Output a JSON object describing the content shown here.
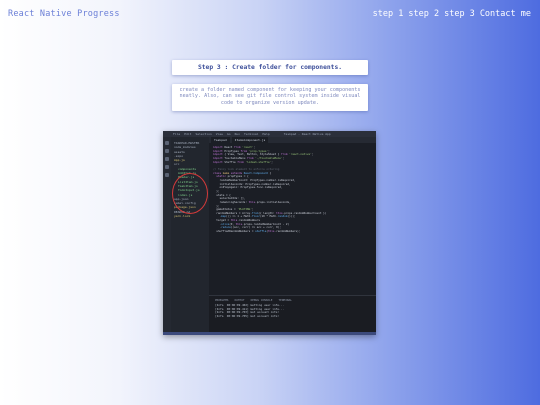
{
  "header": {
    "brand": "React Native Progress",
    "nav": [
      "step 1",
      "step 2",
      "step 3",
      "Contact me"
    ]
  },
  "step": {
    "title": "Step 3 : Create folder for components.",
    "description": "create a folder named component for keeping your components neatly. Also, can see git file control system inside visual code to organize version update."
  },
  "vscode": {
    "title": "Taskpad - React Native App",
    "menu": [
      "File",
      "Edit",
      "Selection",
      "View",
      "Go",
      "Run",
      "Terminal",
      "Help"
    ],
    "tabs": [
      "Taskpad",
      "ItemsComponent.js"
    ],
    "explorer": {
      "items": [
        "TASKPAD-MASTER",
        "node_modules",
        "assets",
        ".expo",
        "App.js",
        "src",
        "components",
        "AddItem.js",
        "Header.js",
        "ListItem.js",
        "TaskItem.js",
        "TodoInput.js",
        "index.js",
        "app.json",
        "babel.config",
        "package.json",
        "README.md",
        "yarn.lock"
      ]
    },
    "panel_tabs": [
      "PROBLEMS",
      "OUTPUT",
      "DEBUG CONSOLE",
      "TERMINAL"
    ],
    "terminal": [
      "[Info  00:06:09.402] Getting user info...",
      "[Info  00:06:09.411] Getting user info...",
      "[Info  00:06:09.703] Got account info!",
      "[Info  00:06:09.705] Got account info!"
    ]
  }
}
